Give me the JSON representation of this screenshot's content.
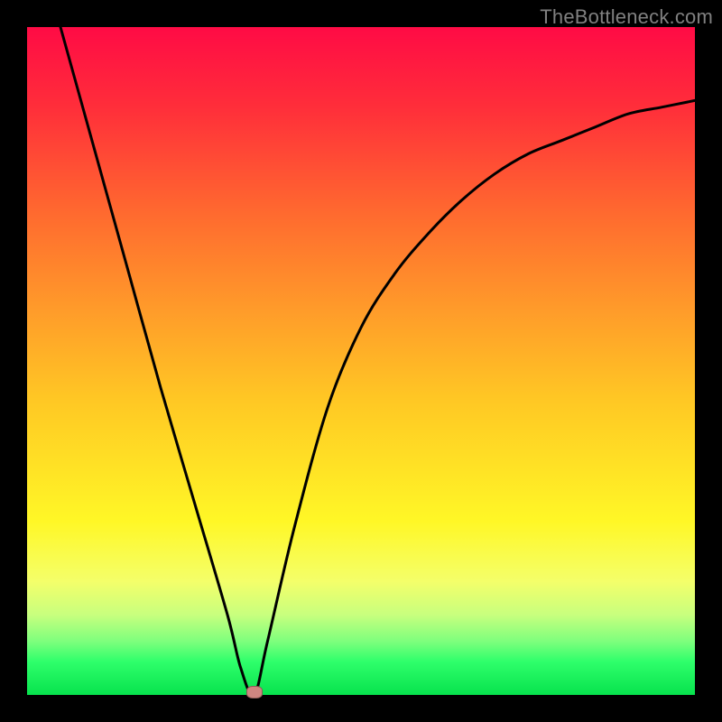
{
  "watermark": "TheBottleneck.com",
  "colors": {
    "background": "#000000",
    "curve": "#000000",
    "marker_fill": "#cf8681",
    "marker_border": "#8b5a56"
  },
  "chart_data": {
    "type": "line",
    "title": "",
    "xlabel": "",
    "ylabel": "",
    "xlim": [
      0,
      100
    ],
    "ylim": [
      0,
      100
    ],
    "grid": false,
    "series": [
      {
        "name": "curve",
        "x": [
          5,
          10,
          15,
          20,
          25,
          30,
          32,
          34,
          36,
          40,
          45,
          50,
          55,
          60,
          65,
          70,
          75,
          80,
          85,
          90,
          95,
          100
        ],
        "y": [
          100,
          82,
          64,
          46,
          29,
          12,
          4,
          0,
          8,
          25,
          43,
          55,
          63,
          69,
          74,
          78,
          81,
          83,
          85,
          87,
          88,
          89
        ]
      }
    ],
    "annotations": [
      {
        "name": "min-marker",
        "x": 34,
        "y": 0
      }
    ],
    "background_gradient": {
      "direction": "top-to-bottom",
      "stops": [
        {
          "pct": 0,
          "color": "#ff0b45"
        },
        {
          "pct": 28,
          "color": "#ff6a2f"
        },
        {
          "pct": 56,
          "color": "#ffc824"
        },
        {
          "pct": 74,
          "color": "#fff726"
        },
        {
          "pct": 92,
          "color": "#7dff7d"
        },
        {
          "pct": 100,
          "color": "#07e24d"
        }
      ]
    }
  }
}
